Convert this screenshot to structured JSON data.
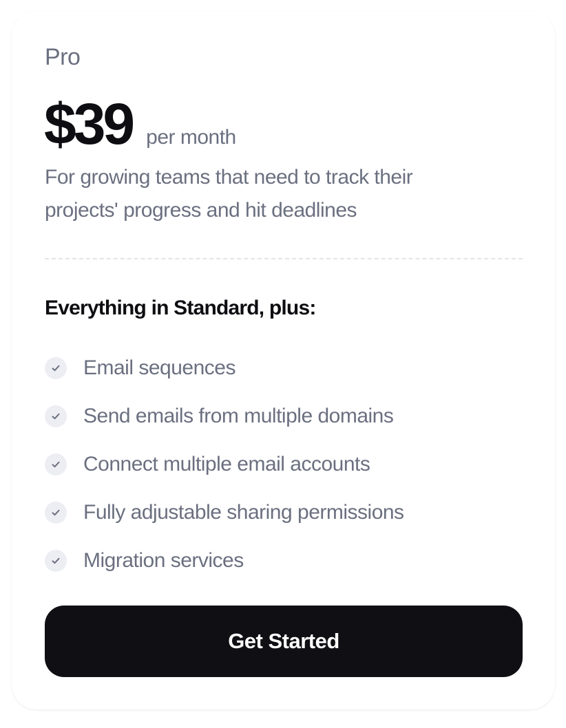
{
  "plan": {
    "name": "Pro",
    "price": "$39",
    "period": "per month",
    "description": "For growing teams that need to track their projects' progress and hit deadlines"
  },
  "features": {
    "heading": "Everything in Standard, plus:",
    "icon": "check-icon",
    "items": [
      {
        "label": "Email sequences"
      },
      {
        "label": "Send emails from multiple domains"
      },
      {
        "label": "Connect multiple email accounts"
      },
      {
        "label": "Fully adjustable sharing permissions"
      },
      {
        "label": "Migration services"
      }
    ]
  },
  "cta": {
    "label": "Get Started"
  },
  "colors": {
    "heading_text": "#0e0e12",
    "muted_text": "#6b7080",
    "button_bg": "#0f0f14",
    "button_text": "#ffffff",
    "check_bg": "#eceef3",
    "check_stroke": "#6b7080",
    "divider": "#e2e4e9"
  }
}
